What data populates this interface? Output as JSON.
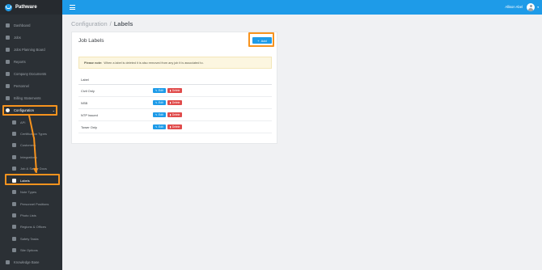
{
  "app": {
    "name": "Pathware"
  },
  "topbar": {
    "user_name": "Allison Abel",
    "user_caret": "▾"
  },
  "sidebar": {
    "items": [
      {
        "label": "Dashboard",
        "icon": "dashboard-icon"
      },
      {
        "label": "Jobs",
        "icon": "hammer-icon"
      },
      {
        "label": "Jobs Planning Board",
        "icon": "board-icon"
      },
      {
        "label": "Reports",
        "icon": "chart-icon"
      },
      {
        "label": "Company Documents",
        "icon": "folder-icon"
      },
      {
        "label": "Personnel",
        "icon": "users-icon"
      },
      {
        "label": "Billing Statements",
        "icon": "file-icon"
      },
      {
        "label": "Configuration",
        "icon": "gear-icon",
        "caret": "⌄"
      }
    ],
    "sub_items": [
      {
        "label": "API",
        "icon": "code-icon"
      },
      {
        "label": "Certification Types",
        "icon": "certificate-icon"
      },
      {
        "label": "Customers",
        "icon": "customers-icon"
      },
      {
        "label": "Integrations",
        "icon": "link-icon"
      },
      {
        "label": "Job & Safety Docs",
        "icon": "doc-icon"
      },
      {
        "label": "Labels",
        "icon": "tag-icon"
      },
      {
        "label": "Note Types",
        "icon": "note-icon"
      },
      {
        "label": "Personnel Positions",
        "icon": "person-icon"
      },
      {
        "label": "Photo Lists",
        "icon": "photo-icon"
      },
      {
        "label": "Regions & Offices",
        "icon": "building-icon"
      },
      {
        "label": "Safety Tasks",
        "icon": "checklist-icon"
      },
      {
        "label": "Site Options",
        "icon": "site-icon"
      }
    ],
    "footer_item": {
      "label": "Knowledge Base",
      "icon": "help-icon"
    }
  },
  "breadcrumb": {
    "parent": "Configuration",
    "separator": "/",
    "current": "Labels"
  },
  "card": {
    "title": "Job Labels",
    "add_label": "Add",
    "add_icon": "+",
    "note_bold": "Please note:",
    "note_text": "When a label is deleted it is also removed from any job it is associated to."
  },
  "table": {
    "header": "Label",
    "edit_label": "Edit",
    "delete_label": "Delete",
    "edit_icon": "✎",
    "delete_icon": "▮",
    "rows": [
      {
        "label": "Civil Only"
      },
      {
        "label": "NSB"
      },
      {
        "label": "NTP Issued"
      },
      {
        "label": "Tower Only"
      }
    ]
  },
  "colors": {
    "accent": "#1e9be8",
    "sidebar": "#2b3035",
    "danger": "#e04b4b",
    "highlight": "#f7931e"
  }
}
